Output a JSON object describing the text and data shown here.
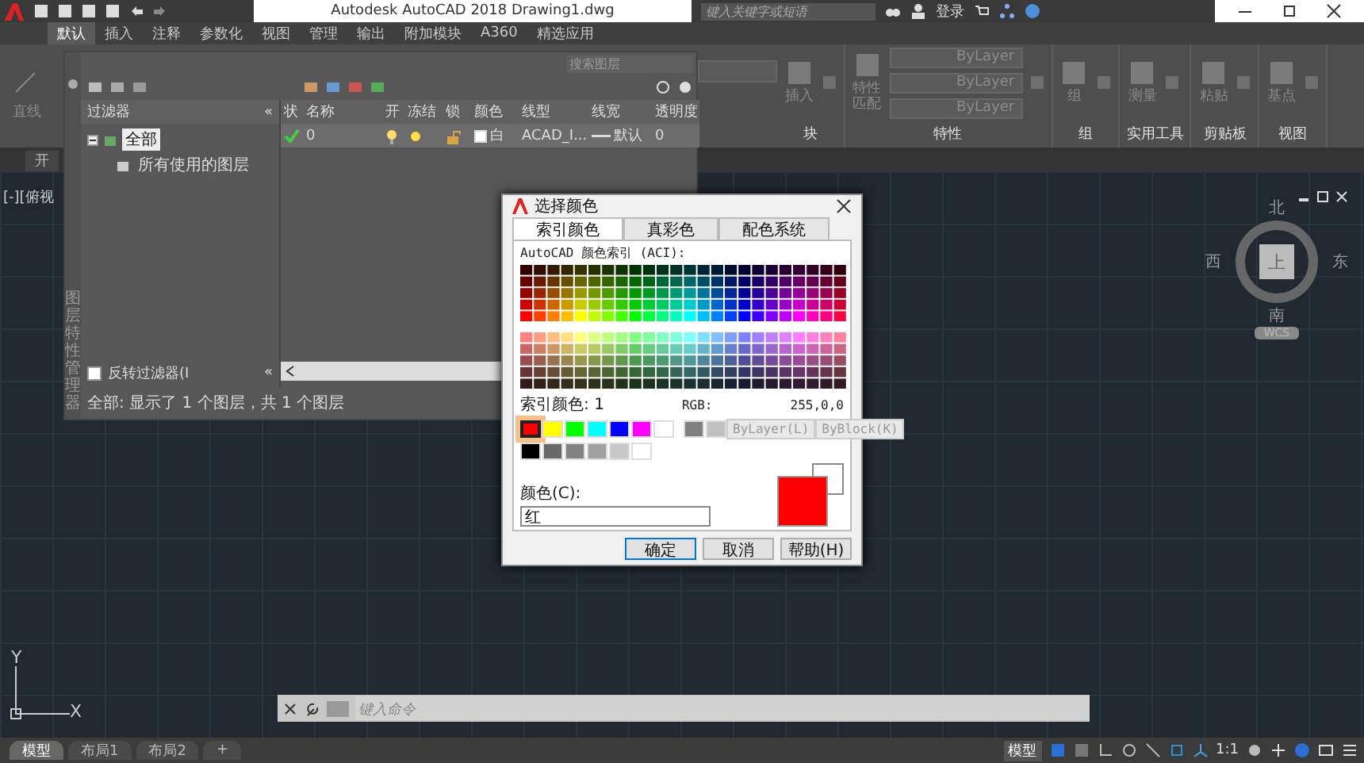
{
  "title_bar": {
    "title": "Autodesk AutoCAD 2018",
    "file": "Drawing1.dwg",
    "search": {
      "placeholder": "键入关键字或短语"
    },
    "sign_in": "登录"
  },
  "ribbon_tabs": [
    {
      "label": "默认",
      "selected": true
    },
    {
      "label": "插入",
      "selected": false
    },
    {
      "label": "注释",
      "selected": false
    },
    {
      "label": "参数化",
      "selected": false
    },
    {
      "label": "视图",
      "selected": false
    },
    {
      "label": "管理",
      "selected": false
    },
    {
      "label": "输出",
      "selected": false
    },
    {
      "label": "附加模块",
      "selected": false
    },
    {
      "label": "A360",
      "selected": false
    },
    {
      "label": "精选应用",
      "selected": false
    }
  ],
  "ribbon": {
    "draw_tool": "直线",
    "groups": [
      {
        "title": "块",
        "tool": "插入"
      },
      {
        "title": "特性",
        "tool": "特性匹配",
        "dropdowns": [
          "ByLayer",
          "ByLayer",
          "ByLayer"
        ]
      },
      {
        "title": "组",
        "tool": "组"
      },
      {
        "title": "实用工具",
        "tool": "测量"
      },
      {
        "title": "剪贴板",
        "tool": "粘贴"
      },
      {
        "title": "视图",
        "tool": "基点"
      }
    ]
  },
  "file_tab": "开",
  "viewport_label": "[-][俯视",
  "layer_manager": {
    "side_title": "图层特性管理器",
    "search": {
      "placeholder": "搜索图层"
    },
    "filter_header": "过滤器",
    "collapse": "«",
    "filters": [
      {
        "label": "全部",
        "selected": true,
        "expanded": true,
        "children": [
          {
            "label": "所有使用的图层",
            "selected": false
          }
        ]
      }
    ],
    "invert_filter": {
      "label": "反转过滤器(I",
      "checked": false
    },
    "collapse_bottom": "«",
    "columns": [
      "状",
      "名称",
      "开",
      "冻结",
      "锁",
      "颜色",
      "线型",
      "线宽",
      "透明度"
    ],
    "layers": [
      {
        "current": true,
        "name": "0",
        "on": true,
        "frozen": false,
        "locked": false,
        "color_name": "白",
        "color": "#ffffff",
        "linetype": "ACAD_I...",
        "lineweight": "默认",
        "transparency": "0",
        "selected": true
      }
    ],
    "status": "全部: 显示了 1 个图层，共 1 个图层"
  },
  "color_dialog": {
    "title": "选择颜色",
    "tabs": [
      {
        "label": "索引颜色",
        "selected": true
      },
      {
        "label": "真彩色",
        "selected": false
      },
      {
        "label": "配色系统",
        "selected": false
      }
    ],
    "aci_label": "AutoCAD 颜色索引 (ACI):",
    "index_label": "索引颜色:",
    "index_value": "1",
    "rgb_label": "RGB:",
    "rgb_value": "255,0,0",
    "swatches": [
      {
        "color": "#ff0000",
        "selected": true
      },
      {
        "color": "#ffff00",
        "selected": false
      },
      {
        "color": "#00ff00",
        "selected": false
      },
      {
        "color": "#00ffff",
        "selected": false
      },
      {
        "color": "#0000ff",
        "selected": false
      },
      {
        "color": "#ff00ff",
        "selected": false
      },
      {
        "color": "#ffffff",
        "selected": false
      }
    ],
    "gray_swatches": [
      {
        "color": "#808080",
        "selected": false
      },
      {
        "color": "#c0c0c0",
        "selected": false
      }
    ],
    "shade_swatches": [
      {
        "color": "#000000",
        "selected": false
      },
      {
        "color": "#696969",
        "selected": false
      },
      {
        "color": "#828282",
        "selected": false
      },
      {
        "color": "#a0a0a0",
        "selected": false
      },
      {
        "color": "#c8c8c8",
        "selected": false
      },
      {
        "color": "#ffffff",
        "selected": false
      }
    ],
    "bylayer": {
      "label": "ByLayer(L)",
      "disabled": true
    },
    "byblock": {
      "label": "ByBlock(K)",
      "disabled": true
    },
    "color_field": {
      "label": "颜色(C):",
      "value": "红"
    },
    "buttons": [
      {
        "label": "确定",
        "default": true
      },
      {
        "label": "取消",
        "default": false
      },
      {
        "label": "帮助(H)",
        "default": false
      }
    ]
  },
  "viewcube": {
    "north": "北",
    "west": "西",
    "top": "上",
    "east": "东",
    "south": "南",
    "wcs": "WCS"
  },
  "ucs": {
    "y": "Y",
    "x": "X"
  },
  "command_line": {
    "placeholder": "键入命令"
  },
  "status_bar": {
    "layouts": [
      {
        "label": "模型",
        "selected": true
      },
      {
        "label": "布局1",
        "selected": false
      },
      {
        "label": "布局2",
        "selected": false
      }
    ],
    "add_tab": "+",
    "model_button": "模型",
    "scale": "1:1"
  }
}
